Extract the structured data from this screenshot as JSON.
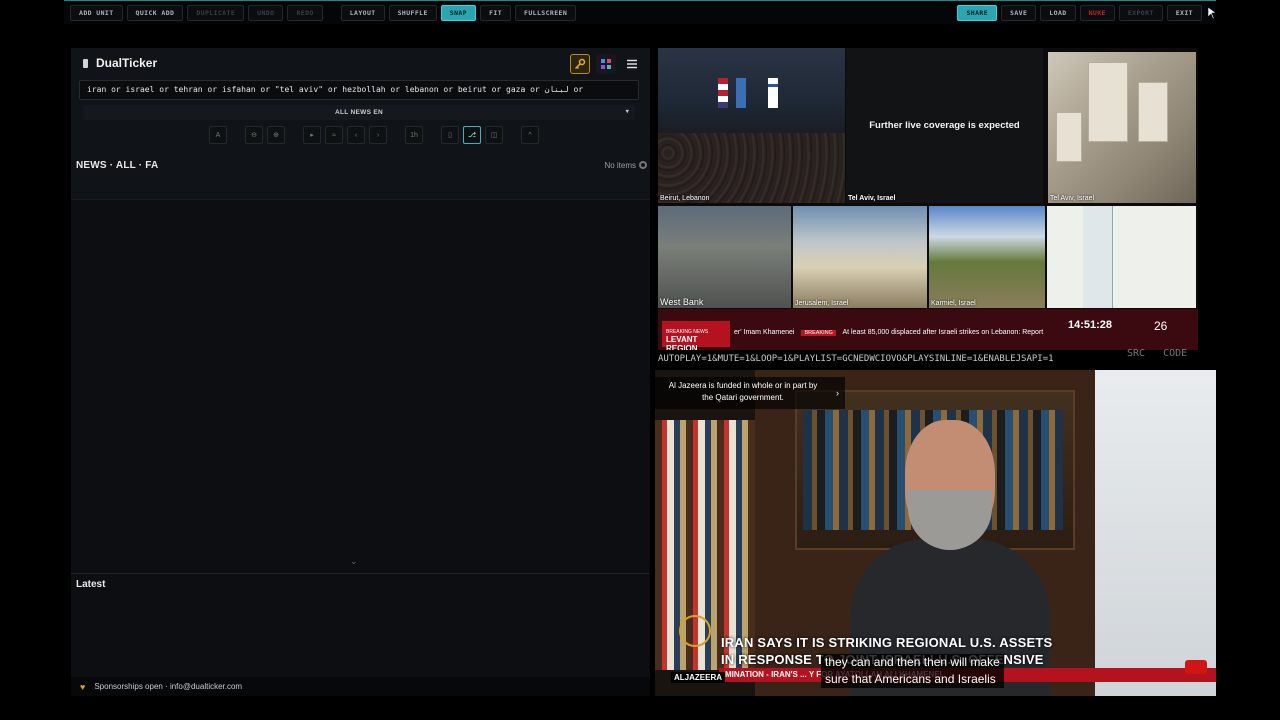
{
  "toolbar": {
    "left": [
      {
        "label": "ADD UNIT",
        "state": "normal"
      },
      {
        "label": "QUICK ADD",
        "state": "normal"
      },
      {
        "label": "DUPLICATE",
        "state": "dim"
      },
      {
        "label": "UNDO",
        "state": "dim"
      },
      {
        "label": "REDO",
        "state": "dim"
      }
    ],
    "middle": [
      {
        "label": "LAYOUT",
        "state": "normal"
      },
      {
        "label": "SHUFFLE",
        "state": "normal"
      },
      {
        "label": "SNAP",
        "state": "active"
      },
      {
        "label": "FIT",
        "state": "normal"
      },
      {
        "label": "FULLSCREEN",
        "state": "normal"
      }
    ],
    "right": [
      {
        "label": "SHARE",
        "state": "active"
      },
      {
        "label": "SAVE",
        "state": "normal"
      },
      {
        "label": "LOAD",
        "state": "normal"
      },
      {
        "label": "NUKE",
        "state": "danger"
      },
      {
        "label": "EXPORT",
        "state": "dim"
      },
      {
        "label": "EXIT",
        "state": "normal"
      }
    ]
  },
  "panel": {
    "brand": "DualTicker",
    "query": "iran or israel or tehran or isfahan or \"tel aviv\" or hezbollah or lebanon or beirut or gaza or لبنان or",
    "feed_select": "ALL NEWS EN",
    "controls": [
      "A",
      "⊖",
      "⊕",
      "▸",
      "≈",
      "‹",
      "›",
      "1h",
      "▯",
      "⎇",
      "◫",
      "^"
    ],
    "news_header": "NEWS · ALL · FA",
    "no_items": "No items",
    "latest": "Latest",
    "footer": "Sponsorships open · info@dualticker.com"
  },
  "wall": {
    "tiles": {
      "pressroom": "Beirut, Lebanon",
      "blackbox_loc": "Tel Aviv, Israel",
      "blackbox_text": "Further live coverage is expected",
      "aerial": "Tel Aviv, Israel",
      "street": "West Bank",
      "jerusalem": "Jerusalem, Israel",
      "karmiel": "Karmiel, Israel"
    },
    "ticker": {
      "region_line1": "BREAKING NEWS",
      "region_line2": "LEVANT REGION",
      "left_text": "er' Imam Khamenei",
      "tag": "BREAKING",
      "headline": "At least 85,000 displaced after Israeli strikes on Lebanon: Report",
      "time": "14:51:28",
      "day": "26"
    }
  },
  "status": {
    "url": "AUTOPLAY=1&MUTE=1&LOOP=1&PLAYLIST=GCNEDWCIOVO&PLAYSINLINE=1&ENABLEJSAPI=1",
    "src": "SRC",
    "code": "CODE"
  },
  "video": {
    "notice_line1": "Al Jazeera is funded in whole or in part by",
    "notice_line2": "the Qatari government.",
    "lower_line1": "IRAN SAYS IT IS STRIKING REGIONAL U.S. ASSETS",
    "lower_line2": "IN RESPONSE TO JOINT ISRAELI-U.S. OFFENSIVE",
    "subtitle_line1": "they can and then then will make",
    "subtitle_line2": "sure that Americans and Israelis",
    "logo_text": "ALJAZEERA",
    "crawl": "MINATION  -  IRAN'S  ...  Y FOR AYATOLLAH ALI KHAMENEI"
  },
  "colors": {
    "accent": "#2aa6b3",
    "danger": "#c0202a",
    "aj_red": "#b3121e"
  }
}
